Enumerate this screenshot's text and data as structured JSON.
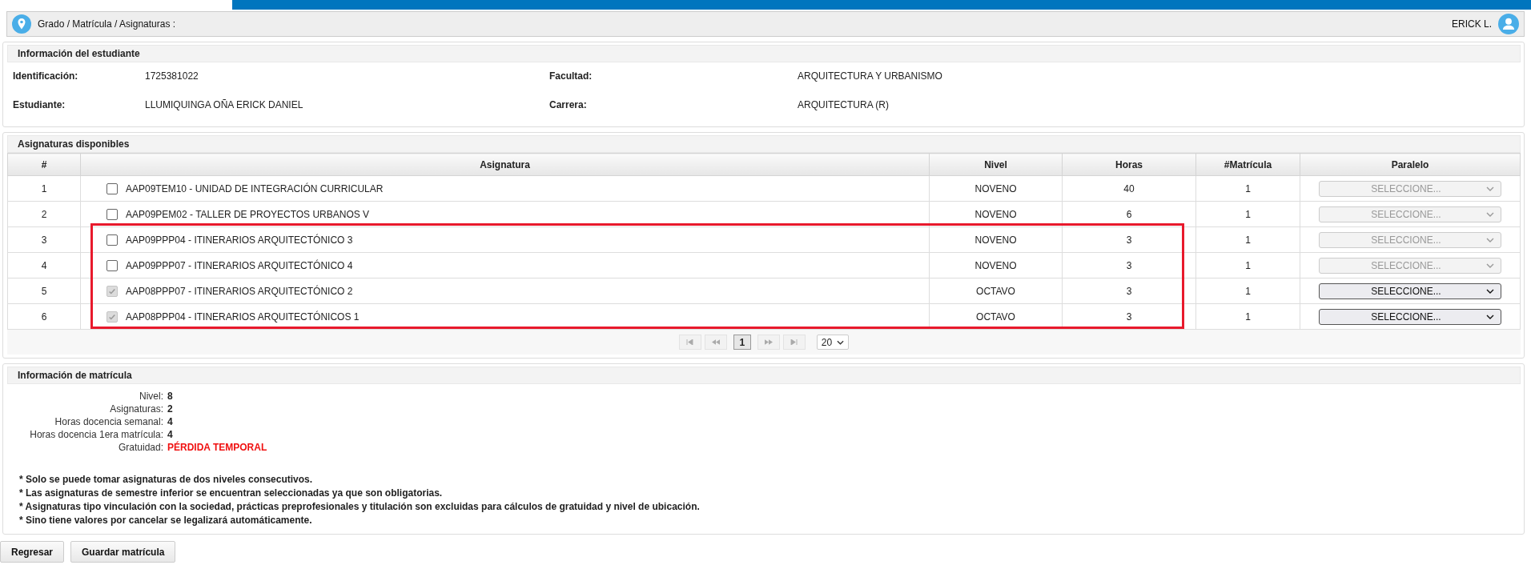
{
  "breadcrumb": {
    "path": "Grado / Matrícula / Asignaturas :",
    "user": "ERICK L."
  },
  "student_panel": {
    "title": "Información del estudiante",
    "fields": [
      {
        "label": "Identificación:",
        "value": "1725381022"
      },
      {
        "label": "Facultad:",
        "value": "ARQUITECTURA Y URBANISMO"
      },
      {
        "label": "Estudiante:",
        "value": "LLUMIQUINGA OÑA ERICK DANIEL"
      },
      {
        "label": "Carrera:",
        "value": "ARQUITECTURA (R)"
      }
    ]
  },
  "subjects_panel": {
    "title": "Asignaturas disponibles",
    "columns": [
      "#",
      "Asignatura",
      "Nivel",
      "Horas",
      "#Matrícula",
      "Paralelo"
    ],
    "rows": [
      {
        "number": "1",
        "checked": false,
        "disabled": false,
        "subject": "AAP09TEM10 - UNIDAD DE INTEGRACIÓN CURRICULAR",
        "level_name": "NOVENO",
        "hours": "40",
        "enrollment": "1",
        "parallel": "SELECCIONE...",
        "parallel_disabled": true,
        "highlighted": false
      },
      {
        "number": "2",
        "checked": false,
        "disabled": false,
        "subject": "AAP09PEM02 - TALLER DE PROYECTOS URBANOS V",
        "level_name": "NOVENO",
        "hours": "6",
        "enrollment": "1",
        "parallel": "SELECCIONE...",
        "parallel_disabled": true,
        "highlighted": false
      },
      {
        "number": "3",
        "checked": false,
        "disabled": false,
        "subject": "AAP09PPP04 - ITINERARIOS ARQUITECTÓNICO 3",
        "level_name": "NOVENO",
        "hours": "3",
        "enrollment": "1",
        "parallel": "SELECCIONE...",
        "parallel_disabled": true,
        "highlighted": true
      },
      {
        "number": "4",
        "checked": false,
        "disabled": false,
        "subject": "AAP09PPP07 - ITINERARIOS ARQUITECTÓNICO 4",
        "level_name": "NOVENO",
        "hours": "3",
        "enrollment": "1",
        "parallel": "SELECCIONE...",
        "parallel_disabled": true,
        "highlighted": true
      },
      {
        "number": "5",
        "checked": true,
        "disabled": true,
        "subject": "AAP08PPP07 - ITINERARIOS ARQUITECTÓNICO 2",
        "level_name": "OCTAVO",
        "hours": "3",
        "enrollment": "1",
        "parallel": "SELECCIONE...",
        "parallel_disabled": false,
        "highlighted": true
      },
      {
        "number": "6",
        "checked": true,
        "disabled": true,
        "subject": "AAP08PPP04 - ITINERARIOS ARQUITECTÓNICOS 1",
        "level_name": "OCTAVO",
        "hours": "3",
        "enrollment": "1",
        "parallel": "SELECCIONE...",
        "parallel_disabled": false,
        "highlighted": true
      }
    ],
    "pager": {
      "pages": [
        {
          "label": "1",
          "selected": true
        }
      ],
      "page_size": "20"
    }
  },
  "enrollment_panel": {
    "title": "Información de matrícula",
    "facts": [
      {
        "label": "Nivel:",
        "value": "8",
        "kind": "normal"
      },
      {
        "label": "Asignaturas:",
        "value": "2",
        "kind": "normal"
      },
      {
        "label": "Horas docencia semanal:",
        "value": "4",
        "kind": "normal"
      },
      {
        "label": "Horas docencia 1era matrícula:",
        "value": "4",
        "kind": "normal"
      },
      {
        "label": "Gratuidad:",
        "value": "PÉRDIDA TEMPORAL",
        "kind": "alert"
      }
    ],
    "notes": [
      "* Solo se puede tomar asignaturas de dos niveles consecutivos.",
      "* Las asignaturas de semestre inferior se encuentran seleccionadas ya que son obligatorias.",
      "* Asignaturas tipo vinculación con la sociedad, prácticas preprofesionales y titulación son excluidas para cálculos de gratuidad y nivel de ubicación.",
      "* Sino tiene valores por cancelar se legalizará automáticamente."
    ]
  },
  "buttons": [
    "Regresar",
    "Guardar matrícula"
  ]
}
